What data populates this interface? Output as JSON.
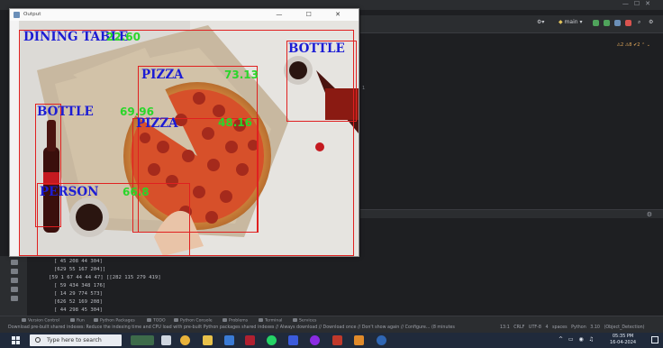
{
  "colors": {
    "box": "#e02020",
    "label": "#1c1cd4",
    "confidence": "#2ad62a",
    "ide_bg": "#1e1f22",
    "taskbar": "#202a3b"
  },
  "ide": {
    "branch": "main",
    "editor_status": "⚠2 ⚠8 ✔2 ⌃ ⌄",
    "line_marker": "1"
  },
  "detection_window": {
    "title": "Output",
    "controls": "—  ☐  ✕",
    "detections": [
      {
        "label": "DINING TABLE",
        "confidence": "22.60"
      },
      {
        "label": "BOTTLE",
        "confidence": ""
      },
      {
        "label": "PIZZA",
        "confidence": "73.13"
      },
      {
        "label": "BOTTLE",
        "confidence": "69.96"
      },
      {
        "label": "PIZZA",
        "confidence": "48.16"
      },
      {
        "label": "PERSON",
        "confidence": "66.8"
      }
    ]
  },
  "console": {
    "lines": [
      "[ 45 208  44 304]",
      "[629  55 167 204]]",
      "[59  1 67 44 44 47] [[282 115 279 419]",
      "[ 59 434 348 176]",
      "[ 14  29 774 573]",
      "[626  52 169 208]",
      "[ 44 298  45 304]"
    ]
  },
  "tool_windows": [
    "Version Control",
    "Run",
    "Python Packages",
    "TODO",
    "Python Console",
    "Problems",
    "Terminal",
    "Services"
  ],
  "status_bar": {
    "message": "Download pre-built shared indexes: Reduce the indexing time and CPU load with pre-built Python packages shared indexes // Always download // Download once // Don't show again // Configure... (8 minutes",
    "right": "13:1  CRLF  UTF-8  4 spaces  Python 3.10 (Object_Detection)"
  },
  "taskbar": {
    "search_placeholder": "Type here to search",
    "time": "05:35 PM",
    "date": "16-04-2024"
  }
}
